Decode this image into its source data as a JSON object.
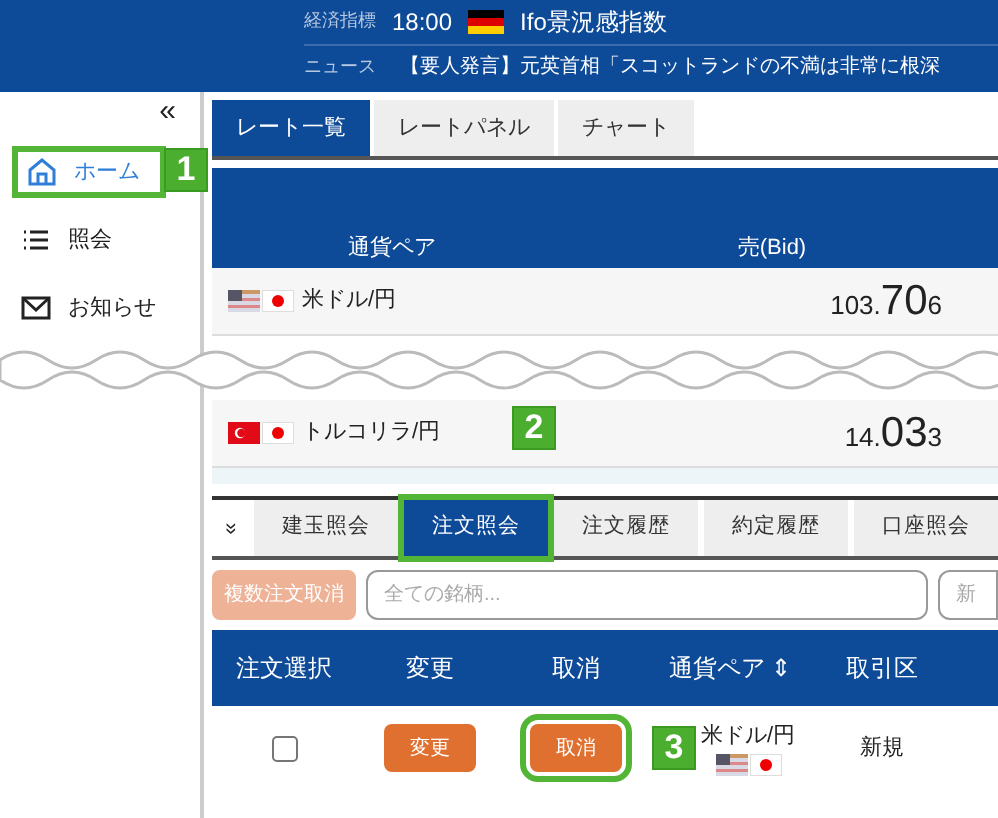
{
  "header": {
    "indicator_label": "経済指標",
    "indicator_time": "18:00",
    "indicator_name": "Ifo景況感指数",
    "news_label": "ニュース",
    "news_text": "【要人発言】元英首相「スコットランドの不満は非常に根深"
  },
  "sidebar": {
    "collapse": "«",
    "items": [
      {
        "label": "ホーム",
        "kind": "home",
        "selected": true,
        "callout": "1"
      },
      {
        "label": "照会",
        "kind": "list",
        "selected": false
      },
      {
        "label": "お知らせ",
        "kind": "mail",
        "selected": false
      }
    ]
  },
  "rate_tabs": [
    {
      "label": "レート一覧",
      "selected": true
    },
    {
      "label": "レートパネル",
      "selected": false
    },
    {
      "label": "チャート",
      "selected": false
    }
  ],
  "rate_table": {
    "columns": [
      "通貨ペア",
      "売(Bid)"
    ],
    "rows": [
      {
        "pair": "米ドル/円",
        "kind": "us",
        "bid_lead": "103.",
        "bid_big": "70",
        "bid_tail": "6"
      },
      {
        "pair": "トルコリラ/円",
        "kind": "tr",
        "bid_lead": "14.",
        "bid_big": "03",
        "bid_tail": "3"
      }
    ]
  },
  "callout_2": "2",
  "order_tabs": {
    "expand": "»",
    "items": [
      {
        "label": "建玉照会",
        "selected": false
      },
      {
        "label": "注文照会",
        "selected": true,
        "callout": true
      },
      {
        "label": "注文履歴",
        "selected": false
      },
      {
        "label": "約定履歴",
        "selected": false
      },
      {
        "label": "口座照会",
        "selected": false
      }
    ]
  },
  "toolbar": {
    "bulk_cancel": {
      "label": "複数注文取消",
      "disabled": true
    },
    "symbol_placeholder": "全ての銘柄...",
    "type_value": "新"
  },
  "order_table": {
    "columns": [
      "注文選択",
      "変更",
      "取消",
      "通貨ペア",
      "取引区"
    ],
    "sort_icon": "⇕",
    "rows": [
      {
        "checked": false,
        "change": "変更",
        "cancel": "取消",
        "cancel_callout": "3",
        "pair": "米ドル/円",
        "type": "新規"
      }
    ]
  }
}
